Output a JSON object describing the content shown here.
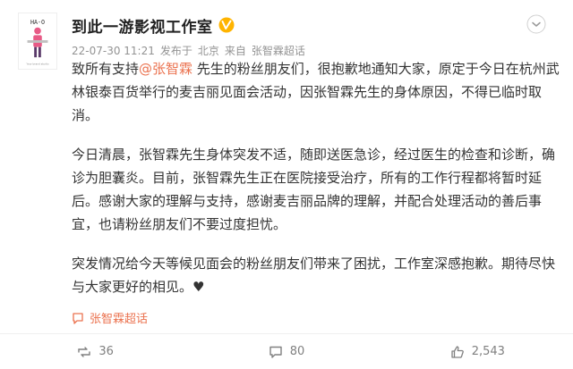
{
  "post": {
    "author": "到此一游影视工作室",
    "avatar": {
      "caption": "HA-O",
      "subtitle": "Your brand studio"
    },
    "meta": {
      "time": "22-07-30 11:21",
      "from_label": "发布于",
      "location": "北京",
      "source_prefix": "来自",
      "source": "张智霖超话"
    },
    "paragraphs": [
      {
        "before": "致所有支持",
        "mention": "@张智霖",
        "after": " 先生的粉丝朋友们，很抱歉地通知大家，原定于今日在杭州武林银泰百货举行的麦吉丽见面会活动，因张智霖先生的身体原因，不得已临时取消。"
      },
      {
        "text": "今日清晨，张智霖先生身体突发不适，随即送医急诊，经过医生的检查和诊断，确诊为胆囊炎。目前，张智霖先生正在医院接受治疗，所有的工作行程都将暂时延后。感谢大家的理解与支持，感谢麦吉丽品牌的理解，并配合处理活动的善后事宜，也请粉丝朋友们不要过度担忧。"
      },
      {
        "text": "突发情况给今天等候见面会的粉丝朋友们带来了困扰，工作室深感抱歉。期待尽快与大家更好的相见。",
        "emoji": "♥"
      }
    ],
    "topic": "张智霖超话"
  },
  "actions": {
    "repost_count": "36",
    "comment_count": "80",
    "like_count": "2,543"
  },
  "colors": {
    "accent": "#eb7350",
    "verified": "#ffb400",
    "text": "#333333",
    "muted": "#939393"
  },
  "icons": [
    "verified-badge-icon",
    "chevron-down-icon",
    "topic-icon",
    "repost-icon",
    "comment-icon",
    "like-icon"
  ]
}
